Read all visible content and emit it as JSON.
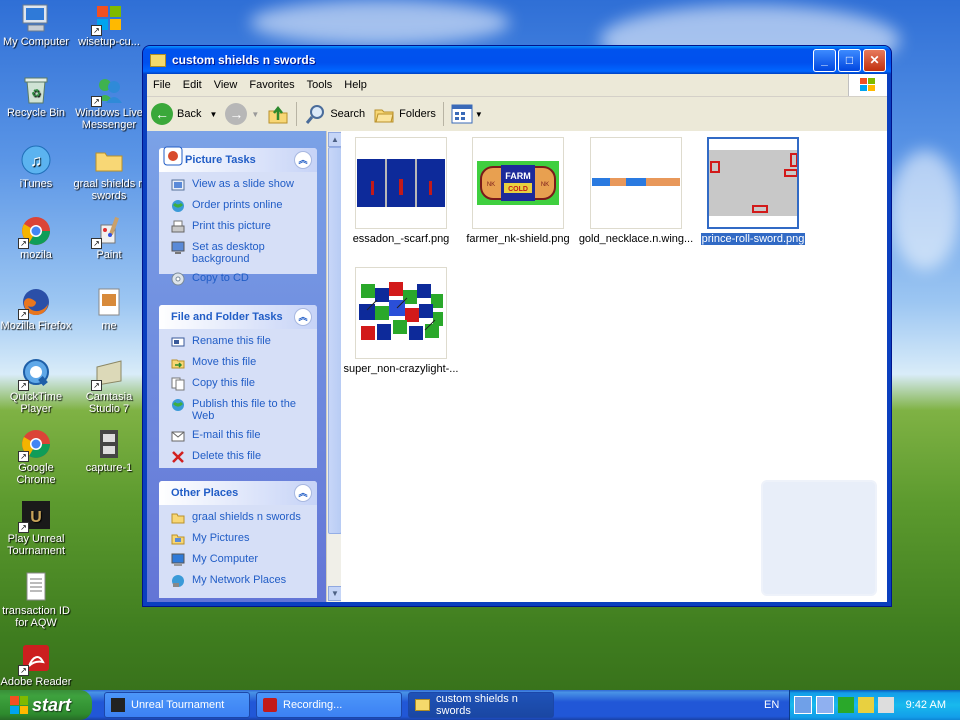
{
  "desktop": {
    "icons": [
      {
        "label": "My Computer"
      },
      {
        "label": "wisetup-cu..."
      },
      {
        "label": "Recycle Bin"
      },
      {
        "label": "Windows Live Messenger"
      },
      {
        "label": "iTunes"
      },
      {
        "label": "graal shields n swords"
      },
      {
        "label": "mozila"
      },
      {
        "label": "Paint"
      },
      {
        "label": "Mozilla Firefox"
      },
      {
        "label": "me"
      },
      {
        "label": "QuickTime Player"
      },
      {
        "label": "Camtasia Studio 7"
      },
      {
        "label": "Google Chrome"
      },
      {
        "label": "capture-1"
      },
      {
        "label": "Play Unreal Tournament"
      },
      {
        "label": "transaction ID for AQW"
      },
      {
        "label": "Adobe Reader"
      }
    ]
  },
  "window": {
    "title": "custom shields n swords",
    "menu": [
      "File",
      "Edit",
      "View",
      "Favorites",
      "Tools",
      "Help"
    ],
    "toolbar": {
      "back": "Back",
      "search": "Search",
      "folders": "Folders"
    }
  },
  "picture_tasks": {
    "title": "Picture Tasks",
    "items": [
      "View as a slide show",
      "Order prints online",
      "Print this picture",
      "Set as desktop background",
      "Copy to CD"
    ]
  },
  "file_tasks": {
    "title": "File and Folder Tasks",
    "items": [
      "Rename this file",
      "Move this file",
      "Copy this file",
      "Publish this file to the Web",
      "E-mail this file",
      "Delete this file"
    ]
  },
  "other_places": {
    "title": "Other Places",
    "items": [
      "graal shields n swords",
      "My Pictures",
      "My Computer",
      "My Network Places"
    ]
  },
  "files": [
    {
      "name": "essadon_-scarf.png"
    },
    {
      "name": "farmer_nk-shield.png",
      "thumb_text_top": "FARM",
      "thumb_text_bottom": "COLD",
      "side_left": "NK",
      "side_right": "NK"
    },
    {
      "name": "gold_necklace.n.wing..."
    },
    {
      "name": "prince-roll-sword.png",
      "selected": true
    },
    {
      "name": "super_non-crazylight-..."
    }
  ],
  "taskbar": {
    "start": "start",
    "tasks": [
      "Unreal Tournament",
      "Recording...",
      "custom shields n swords"
    ],
    "lang": "EN",
    "clock": "9:42 AM"
  }
}
